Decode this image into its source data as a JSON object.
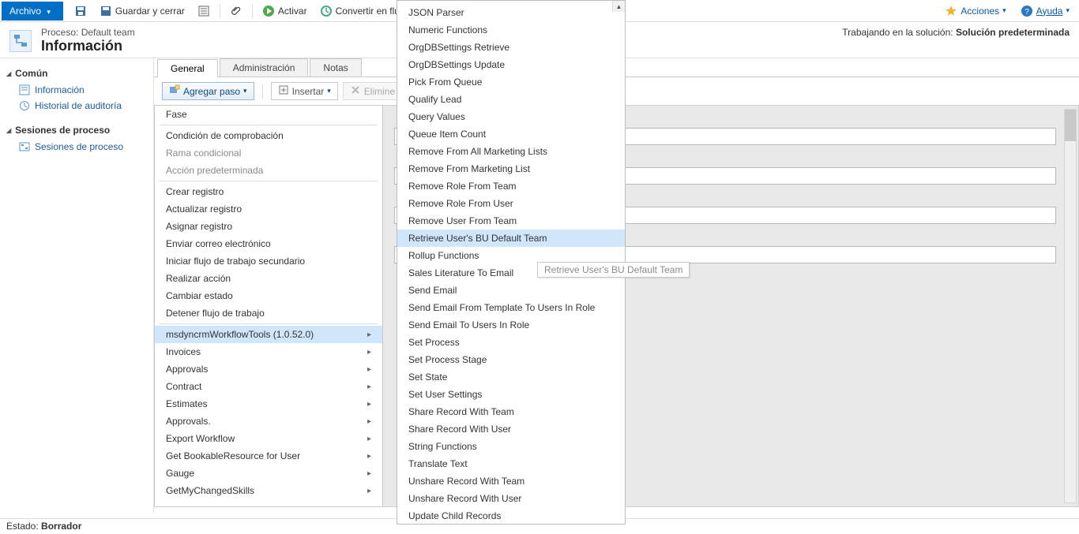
{
  "ribbon": {
    "archivo": "Archivo",
    "guardar_cerrar": "Guardar y cerrar",
    "activar": "Activar",
    "convertir": "Convertir en flujo de",
    "acciones": "Acciones",
    "ayuda": "Ayuda"
  },
  "header": {
    "process_line": "Proceso: Default team",
    "title": "Información",
    "solution_prefix": "Trabajando en la solución:",
    "solution_name": "Solución predeterminada"
  },
  "nav": {
    "comun_title": "Común",
    "comun_items": [
      "Información",
      "Historial de auditoría"
    ],
    "sesiones_title": "Sesiones de proceso",
    "sesiones_items": [
      "Sesiones de proceso"
    ]
  },
  "tabs": {
    "general": "General",
    "admin": "Administración",
    "notas": "Notas"
  },
  "toolbar": {
    "agregar_paso": "Agregar paso",
    "insertar": "Insertar",
    "eliminar": "Elimine este paso"
  },
  "add_step_menu": {
    "items": [
      {
        "label": "Fase"
      },
      {
        "label": "Condición de comprobación"
      },
      {
        "label": "Rama condicional",
        "muted": true
      },
      {
        "label": "Acción predeterminada",
        "muted": true
      },
      {
        "label": "Crear registro"
      },
      {
        "label": "Actualizar registro"
      },
      {
        "label": "Asignar registro"
      },
      {
        "label": "Enviar correo electrónico"
      },
      {
        "label": "Iniciar flujo de trabajo secundario"
      },
      {
        "label": "Realizar acción"
      },
      {
        "label": "Cambiar estado"
      },
      {
        "label": "Detener flujo de trabajo"
      },
      {
        "label": "msdyncrmWorkflowTools (1.0.52.0)",
        "sel": true,
        "submenu": true
      },
      {
        "label": "Invoices",
        "submenu": true
      },
      {
        "label": "Approvals",
        "submenu": true
      },
      {
        "label": "Contract",
        "submenu": true
      },
      {
        "label": "Estimates",
        "submenu": true
      },
      {
        "label": "Approvals.",
        "submenu": true
      },
      {
        "label": "Export Workflow",
        "submenu": true
      },
      {
        "label": "Get BookableResource for User",
        "submenu": true
      },
      {
        "label": "Gauge",
        "submenu": true
      },
      {
        "label": "GetMyChangedSkills",
        "submenu": true
      }
    ]
  },
  "submenu": {
    "items": [
      "JSON Parser",
      "Numeric Functions",
      "OrgDBSettings Retrieve",
      "OrgDBSettings Update",
      "Pick From Queue",
      "Qualify Lead",
      "Query Values",
      "Queue Item Count",
      "Remove From All Marketing Lists",
      "Remove From Marketing List",
      "Remove Role From Team",
      "Remove Role From User",
      "Remove User From Team",
      "Retrieve User's BU Default Team",
      "Rollup Functions",
      "Sales Literature To Email",
      "Send Email",
      "Send Email From Template To Users In Role",
      "Send Email To Users In Role",
      "Set Process",
      "Set Process Stage",
      "Set State",
      "Set User Settings",
      "Share Record With Team",
      "Share Record With User",
      "String Functions",
      "Translate Text",
      "Unshare Record With Team",
      "Unshare Record With User",
      "Update Child Records"
    ],
    "highlighted_index": 13,
    "tooltip": "Retrieve User's BU Default Team"
  },
  "status": {
    "label": "Estado:",
    "value": "Borrador"
  }
}
